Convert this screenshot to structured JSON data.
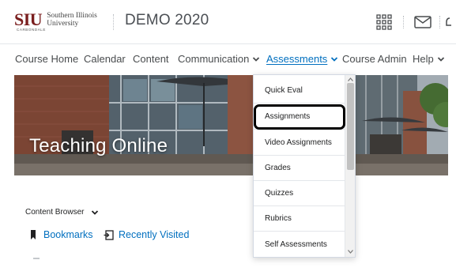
{
  "header": {
    "logo_text": "SIU",
    "logo_subtext_line1": "Southern Illinois",
    "logo_subtext_line2": "University",
    "logo_small": "CARBONDALE",
    "org_title": "DEMO 2020",
    "icons": [
      "grid-icon",
      "mail-icon"
    ]
  },
  "nav": {
    "items": [
      {
        "label": "Course Home"
      },
      {
        "label": "Calendar"
      },
      {
        "label": "Content"
      },
      {
        "label": "Communication",
        "has_menu": true
      },
      {
        "label": "Assessments",
        "has_menu": true,
        "active": true
      },
      {
        "label": "Course Admin"
      },
      {
        "label": "Help",
        "has_menu": true
      }
    ]
  },
  "banner": {
    "title": "Teaching Online"
  },
  "content_browser": {
    "title": "Content Browser",
    "links": [
      {
        "label": "Bookmarks",
        "icon": "bookmark-icon"
      },
      {
        "label": "Recently Visited",
        "icon": "recently-visited-icon"
      }
    ]
  },
  "assessments_menu": {
    "items": [
      {
        "label": "Quick Eval"
      },
      {
        "label": "Assignments",
        "highlighted": true
      },
      {
        "label": "Video Assignments"
      },
      {
        "label": "Grades"
      },
      {
        "label": "Quizzes"
      },
      {
        "label": "Rubrics"
      },
      {
        "label": "Self Assessments"
      }
    ]
  },
  "colors": {
    "link": "#006fbf",
    "brand": "#7a1e1e",
    "highlight_border": "#000000"
  }
}
